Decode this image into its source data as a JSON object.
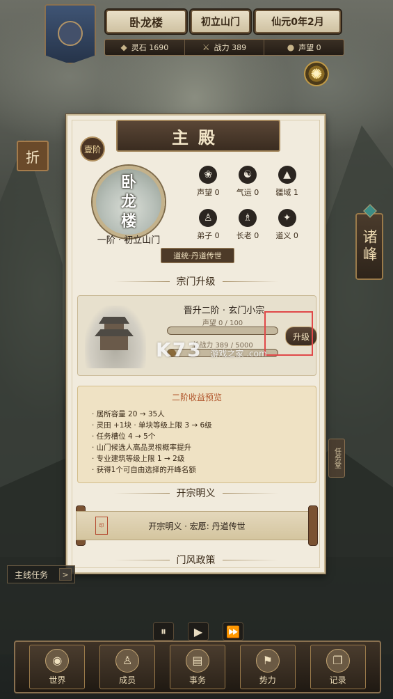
{
  "top": {
    "sect_name": "卧龙楼",
    "stage": "初立山门",
    "date": "仙元0年2月"
  },
  "stats": [
    {
      "icon": "spirit-stone-icon",
      "label": "灵石 1690"
    },
    {
      "icon": "combat-power-icon",
      "label": "战力 389"
    },
    {
      "icon": "reputation-icon",
      "label": "声望 0"
    }
  ],
  "sidebar": {
    "fold_label": "折",
    "peaks_label": "诸峰",
    "task_hall_label": "任务堂"
  },
  "panel": {
    "title": "主殿",
    "rank_badge": "壹阶",
    "emblem_lines": [
      "卧",
      "龙",
      "楼"
    ],
    "sect_rank": "一阶 · 初立山门",
    "dao_tag": "道统·丹道传世",
    "attributes": [
      {
        "icon": "reputation-icon",
        "label": "声望 0"
      },
      {
        "icon": "fortune-icon",
        "label": "气运 0"
      },
      {
        "icon": "territory-icon",
        "label": "疆域 1"
      },
      {
        "icon": "disciple-icon",
        "label": "弟子 0"
      },
      {
        "icon": "elder-icon",
        "label": "长老 0"
      },
      {
        "icon": "righteousness-icon",
        "label": "道义 0"
      }
    ],
    "upgrade_section": "宗门升级",
    "upgrade": {
      "title": "晋升二阶 · 玄门小宗",
      "reputation_bar": {
        "label": "声望 0 / 100",
        "progress": 0
      },
      "power_bar": {
        "label": "总战力 389 / 5000",
        "progress": 0.078
      },
      "button": "升级"
    },
    "watermark": "K73",
    "watermark_sub": "游戏之家 .com",
    "preview": {
      "title": "二阶收益预览",
      "items": [
        "· 居所容量 20 → 35人",
        "· 灵田 +1块 · 单块等级上限 3 → 6级",
        "· 任务槽位 4 → 5个",
        "· 山门候选人高品灵根概率提升",
        "· 专业建筑等级上限 1 → 2级",
        "· 获得1个可自由选择的开峰名额"
      ]
    },
    "founding_section": "开宗明义",
    "founding_text": "开宗明义 · 宏愿: 丹道传世",
    "policy_section": "门风政策"
  },
  "main_task": {
    "label": "主线任务",
    "arrow": ">"
  },
  "speed": [
    "⏸",
    "▶",
    "⏩"
  ],
  "nav": [
    {
      "icon": "world-icon",
      "label": "世界"
    },
    {
      "icon": "members-icon",
      "label": "成员"
    },
    {
      "icon": "affairs-icon",
      "label": "事务"
    },
    {
      "icon": "forces-icon",
      "label": "势力"
    },
    {
      "icon": "records-icon",
      "label": "记录"
    }
  ]
}
